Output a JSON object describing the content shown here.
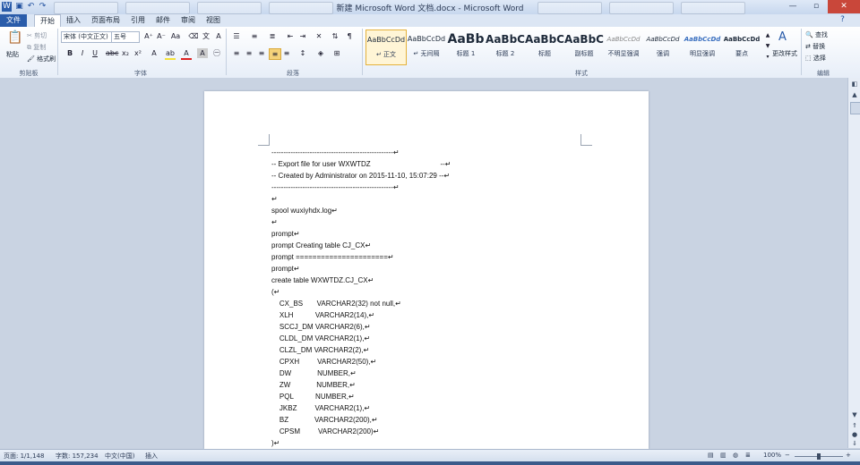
{
  "window": {
    "title": "新建 Microsoft Word 文档.docx - Microsoft Word",
    "minimize": "—",
    "maximize": "▫",
    "close": "✕"
  },
  "tabs": [
    "文件",
    "开始",
    "插入",
    "页面布局",
    "引用",
    "邮件",
    "审阅",
    "视图"
  ],
  "ribbon": {
    "clipboard": {
      "paste": "粘贴",
      "cut": "剪切",
      "copy": "复制",
      "format_painter": "格式刷",
      "label": "剪贴板"
    },
    "font": {
      "name": "宋体 (中文正文)",
      "size": "五号",
      "label": "字体"
    },
    "paragraph": {
      "label": "段落"
    },
    "styles": {
      "label": "样式",
      "items": [
        {
          "sample": "AaBbCcDd",
          "name": "↵ 正文"
        },
        {
          "sample": "AaBbCcDd",
          "name": "↵ 无间隔"
        },
        {
          "sample": "AaBb",
          "name": "标题 1"
        },
        {
          "sample": "AaBbC",
          "name": "标题 2"
        },
        {
          "sample": "AaBbC",
          "name": "标题"
        },
        {
          "sample": "AaBbC",
          "name": "副标题"
        },
        {
          "sample": "AaBbCcDd",
          "name": "不明显强调"
        },
        {
          "sample": "AaBbCcDd",
          "name": "强调"
        },
        {
          "sample": "AaBbCcDd",
          "name": "明显强调"
        },
        {
          "sample": "AaBbCcDd",
          "name": "要点"
        }
      ],
      "change_styles": "更改样式"
    },
    "editing": {
      "find": "查找",
      "replace": "替换",
      "select": "选择",
      "label": "编辑"
    }
  },
  "document": {
    "lines": [
      "---------------------------------------------------↵",
      "-- Export file for user WXWTDZ                                   --↵",
      "-- Created by Administrator on 2015-11-10, 15:07:29 --↵",
      "---------------------------------------------------↵",
      "↵",
      "spool wuxiyhdx.log↵",
      "↵",
      "prompt↵",
      "prompt Creating table CJ_CX↵",
      "prompt ======================↵",
      "prompt↵",
      "create table WXWTDZ.CJ_CX↵",
      "(↵",
      "    CX_BS       VARCHAR2(32) not null,↵",
      "    XLH           VARCHAR2(14),↵",
      "    SCCJ_DM VARCHAR2(6),↵",
      "    CLDL_DM VARCHAR2(1),↵",
      "    CLZL_DM VARCHAR2(2),↵",
      "    CPXH         VARCHAR2(50),↵",
      "    DW             NUMBER,↵",
      "    ZW             NUMBER,↵",
      "    PQL           NUMBER,↵",
      "    JKBZ         VARCHAR2(1),↵",
      "    BZ             VARCHAR2(200),↵",
      "    CPSM         VARCHAR2(200)↵",
      ")↵"
    ]
  },
  "status": {
    "page": "页面: 1/1,148",
    "words": "字数: 157,234",
    "language": "中文(中国)",
    "mode": "插入",
    "zoom": "100%"
  },
  "colors": {
    "file_tab": "#2a5caa",
    "close": "#c9473a"
  }
}
